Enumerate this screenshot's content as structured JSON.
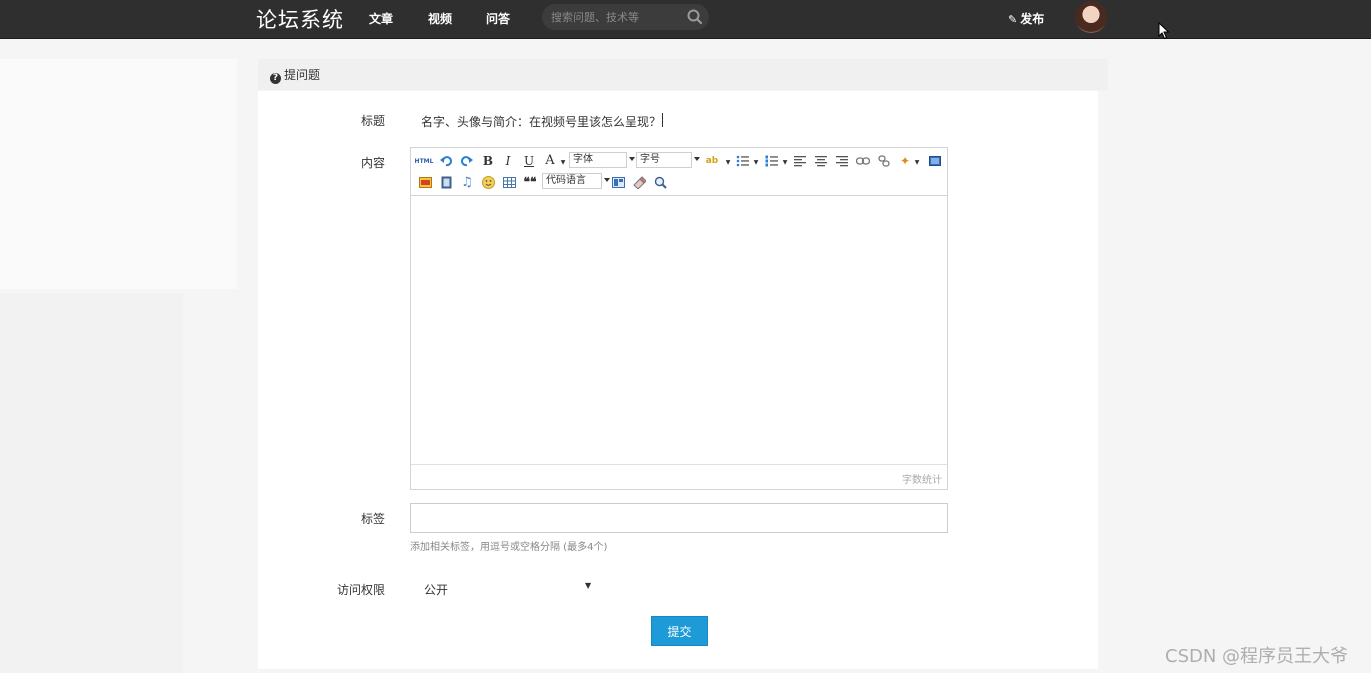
{
  "nav": {
    "brand": "论坛系统",
    "links": [
      "文章",
      "视频",
      "问答"
    ],
    "search_placeholder": "搜索问题、技术等",
    "publish_label": "发布"
  },
  "panel": {
    "title": "提问题"
  },
  "form": {
    "title_label": "标题",
    "title_value": "名字、头像与简介：在视频号里该怎么呈现？",
    "content_label": "内容",
    "font_family_placeholder": "字体",
    "font_size_placeholder": "字号",
    "code_language_placeholder": "代码语言",
    "word_count_label": "字数统计",
    "tags_label": "标签",
    "tags_value": "",
    "tags_hint": "添加相关标签，用逗号或空格分隔 (最多4个)",
    "access_label": "访问权限",
    "access_value": "公开",
    "submit_label": "提交"
  },
  "watermark": "CSDN @程序员王大爷",
  "colors": {
    "nav_bg": "#2f2f2f",
    "submit_bg": "#1e9bd7"
  }
}
